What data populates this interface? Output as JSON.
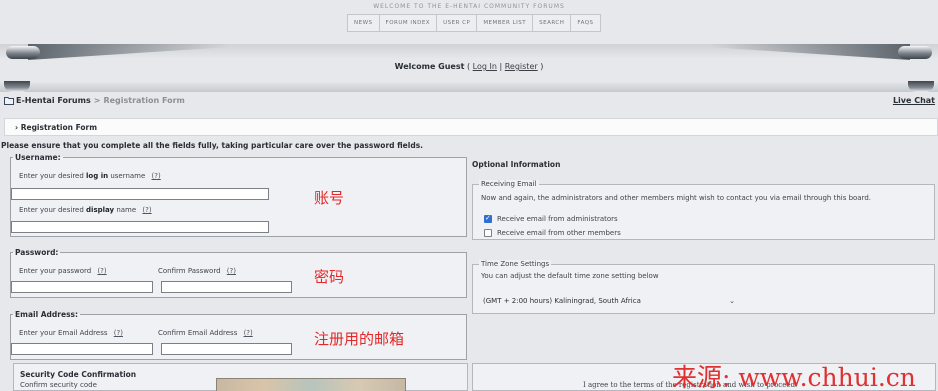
{
  "header": {
    "welcome_banner": "WELCOME TO THE E-HENTAI COMMUNITY FORUMS",
    "nav": [
      "NEWS",
      "FORUM INDEX",
      "USER CP",
      "MEMBER LIST",
      "SEARCH",
      "FAQS"
    ],
    "welcome_guest_prefix": "Welcome Guest",
    "welcome_open": "(",
    "login_link": "Log In",
    "pipe": "|",
    "register_link": "Register",
    "welcome_close": ")"
  },
  "breadcrumb": {
    "forum": "E-Hentai Forums",
    "sep": ">",
    "current": "Registration Form"
  },
  "live_chat": "Live Chat",
  "section_title": "› Registration Form",
  "notice": "Please ensure that you complete all the fields fully, taking particular care over the password fields.",
  "username": {
    "legend": "Username:",
    "login_pre": "Enter your desired",
    "login_bold": "log in",
    "login_post": "username",
    "display_pre": "Enter your desired",
    "display_bold": "display",
    "display_post": "name",
    "help": "(?)",
    "login_value": "",
    "display_value": ""
  },
  "password": {
    "legend": "Password:",
    "enter_label": "Enter your password",
    "confirm_label": "Confirm Password",
    "help": "(?)"
  },
  "email": {
    "legend": "Email Address:",
    "enter_label": "Enter your Email Address",
    "confirm_label": "Confirm Email Address",
    "help": "(?)"
  },
  "annotations": {
    "account": "账号",
    "password": "密码",
    "email": "注册用的邮箱"
  },
  "optional": {
    "title": "Optional Information",
    "receiving_legend": "Receiving Email",
    "receiving_text": "Now and again, the administrators and other members might wish to contact you via email through this board.",
    "cb_admin_label": "Receive email from administrators",
    "cb_admin_checked": true,
    "cb_members_label": "Receive email from other members",
    "cb_members_checked": false,
    "tz_legend": "Time Zone Settings",
    "tz_text": "You can adjust the default time zone setting below",
    "tz_value": "(GMT + 2:00 hours) Kaliningrad, South Africa"
  },
  "security": {
    "title": "Security Code Confirmation",
    "subtitle": "Confirm security code"
  },
  "terms_text": "I agree to the terms of the registration and wish to proceed.",
  "watermark": "来源: www.chhui.cn",
  "colors": {
    "annotation_red": "#e42828",
    "checkbox_blue": "#2f6fd1",
    "panel_bg": "#eff1f4"
  }
}
